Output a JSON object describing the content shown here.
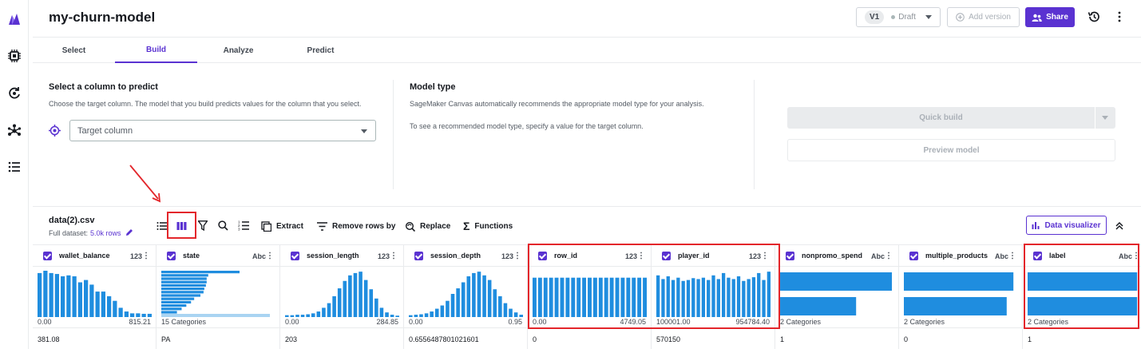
{
  "app": {
    "title": "my-churn-model"
  },
  "version": {
    "label": "V1",
    "status": "Draft"
  },
  "header": {
    "add_version": "Add version",
    "share": "Share"
  },
  "tabs": [
    {
      "label": "Select"
    },
    {
      "label": "Build"
    },
    {
      "label": "Analyze"
    },
    {
      "label": "Predict"
    }
  ],
  "target": {
    "title": "Select a column to predict",
    "desc": "Choose the target column. The model that you build predicts values for the column that you select.",
    "placeholder": "Target column"
  },
  "model_type": {
    "title": "Model type",
    "desc": "SageMaker Canvas automatically recommends the appropriate model type for your analysis.",
    "hint": "To see a recommended model type, specify a value for the target column."
  },
  "actions": {
    "quick_build": "Quick build",
    "preview": "Preview model"
  },
  "dataset": {
    "name": "data(2).csv",
    "full_label": "Full dataset:",
    "rows": "5.0k rows"
  },
  "toolbar": {
    "extract": "Extract",
    "remove_rows": "Remove rows by",
    "replace": "Replace",
    "functions": "Functions",
    "data_visualizer": "Data visualizer"
  },
  "colors": {
    "accent": "#5a32d1",
    "bar": "#1f8ddf",
    "highlight": "#e3262b"
  },
  "columns": [
    {
      "name": "wallet_balance",
      "type": "123",
      "min": "0.00",
      "max": "815.21",
      "first_value": "381.08",
      "kind": "hist",
      "bars": [
        0.95,
        1,
        0.95,
        0.93,
        0.88,
        0.9,
        0.88,
        0.75,
        0.8,
        0.7,
        0.55,
        0.55,
        0.45,
        0.35,
        0.2,
        0.12,
        0.08,
        0.08,
        0.07,
        0.07
      ]
    },
    {
      "name": "state",
      "type": "Abc",
      "min": "15 Categories",
      "max": "",
      "first_value": "PA",
      "kind": "hbars",
      "hbars": [
        1,
        0.6,
        0.58,
        0.58,
        0.57,
        0.55,
        0.54,
        0.5,
        0.42,
        0.38,
        0.32,
        0.26,
        0.2
      ]
    },
    {
      "name": "session_length",
      "type": "123",
      "min": "0.00",
      "max": "284.85",
      "first_value": "203",
      "kind": "hist",
      "bars": [
        0.04,
        0.04,
        0.05,
        0.05,
        0.06,
        0.08,
        0.12,
        0.2,
        0.3,
        0.45,
        0.62,
        0.78,
        0.9,
        0.95,
        0.98,
        0.8,
        0.6,
        0.4,
        0.2,
        0.1,
        0.05,
        0.03
      ]
    },
    {
      "name": "session_depth",
      "type": "123",
      "min": "0.00",
      "max": "0.95",
      "first_value": "0.6556487801021601",
      "kind": "hist",
      "bars": [
        0.04,
        0.05,
        0.06,
        0.08,
        0.12,
        0.18,
        0.25,
        0.35,
        0.5,
        0.62,
        0.75,
        0.88,
        0.95,
        0.98,
        0.9,
        0.8,
        0.6,
        0.45,
        0.3,
        0.18,
        0.1,
        0.05
      ]
    },
    {
      "name": "row_id",
      "type": "123",
      "min": "0.00",
      "max": "4749.05",
      "first_value": "0",
      "kind": "hist",
      "bars": [
        0.85,
        0.85,
        0.85,
        0.85,
        0.85,
        0.85,
        0.85,
        0.85,
        0.85,
        0.85,
        0.85,
        0.85,
        0.85,
        0.85,
        0.85,
        0.85,
        0.85,
        0.85,
        0.85,
        0.85,
        0.85
      ]
    },
    {
      "name": "player_id",
      "type": "123",
      "min": "100001.00",
      "max": "954784.40",
      "first_value": "570150",
      "kind": "hist",
      "bars": [
        0.9,
        0.82,
        0.88,
        0.8,
        0.85,
        0.78,
        0.8,
        0.84,
        0.82,
        0.85,
        0.8,
        0.9,
        0.82,
        0.95,
        0.85,
        0.82,
        0.88,
        0.78,
        0.82,
        0.86,
        0.95,
        0.8,
        0.98
      ]
    },
    {
      "name": "nonpromo_spend",
      "type": "Abc",
      "min": "2 Categories",
      "max": "",
      "first_value": "1",
      "kind": "cat",
      "cat": [
        1,
        0.68
      ]
    },
    {
      "name": "multiple_products",
      "type": "Abc",
      "min": "2 Categories",
      "max": "",
      "first_value": "0",
      "kind": "cat",
      "cat": [
        0.98,
        0.92
      ]
    },
    {
      "name": "label",
      "type": "Abc",
      "min": "2 Categories",
      "max": "",
      "first_value": "1",
      "kind": "cat",
      "cat": [
        0.98,
        0.98
      ]
    }
  ]
}
